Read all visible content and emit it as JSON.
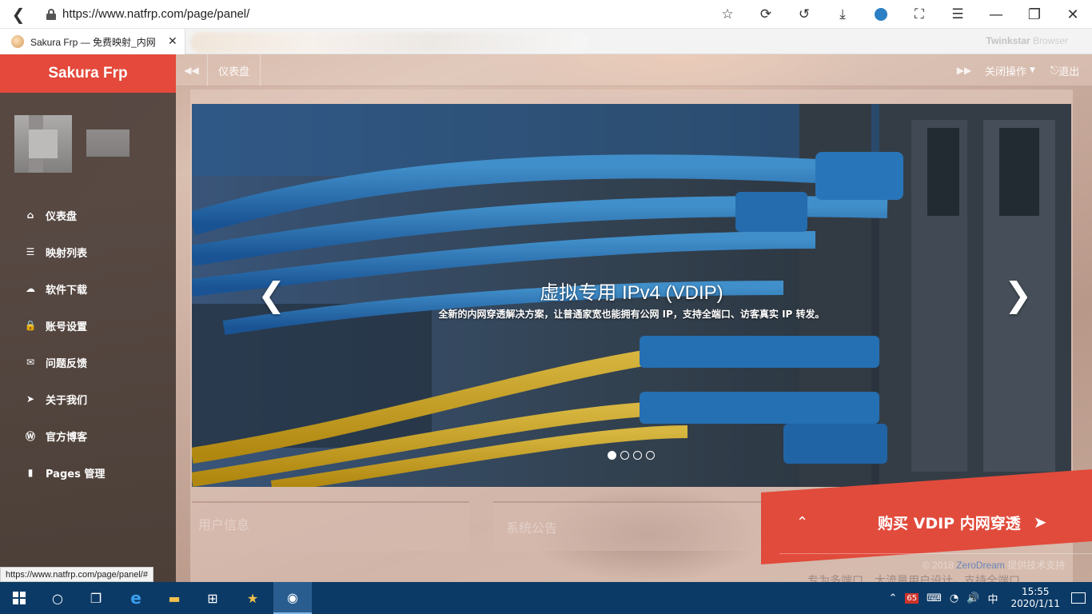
{
  "browser": {
    "url": "https://www.natfrp.com/page/panel/",
    "tab_title": "Sakura Frp — 免费映射_内网",
    "brand_name": "Twinkstar",
    "brand_suffix": " Browser",
    "status_url": "https://www.natfrp.com/page/panel/#"
  },
  "sidebar": {
    "logo": "Sakura Frp",
    "items": [
      {
        "label": "仪表盘",
        "icon": "home-icon",
        "glyph": "⌂"
      },
      {
        "label": "映射列表",
        "icon": "list-icon",
        "glyph": "☰"
      },
      {
        "label": "软件下载",
        "icon": "cloud-download-icon",
        "glyph": "☁"
      },
      {
        "label": "账号设置",
        "icon": "lock-icon",
        "glyph": "🔒"
      },
      {
        "label": "问题反馈",
        "icon": "envelope-icon",
        "glyph": "✉"
      },
      {
        "label": "关于我们",
        "icon": "paper-plane-icon",
        "glyph": "➤"
      },
      {
        "label": "官方博客",
        "icon": "wordpress-icon",
        "glyph": "Ⓦ"
      },
      {
        "label": "Pages 管理",
        "icon": "file-icon",
        "glyph": "▮"
      }
    ]
  },
  "topnav": {
    "breadcrumb": "仪表盘",
    "ops_label": "关闭操作",
    "logout_label": "退出"
  },
  "carousel": {
    "title": "虚拟专用 IPv4 (VDIP)",
    "subtitle": "全新的内网穿透解决方案，让普通家宽也能拥有公网 IP，支持全端口、访客真实 IP 转发。",
    "slide_count": 4,
    "active_index": 0
  },
  "panels": {
    "user_info": "用户信息",
    "notice": "系统公告"
  },
  "buy_button": {
    "label": "购买 VDIP 内网穿透"
  },
  "footer": {
    "copyright": "© 2018 ",
    "company": "ZeroDream",
    "support": " 提供技术支持",
    "marquee": "专为多端口、大流量用户设计，支持全端口"
  },
  "taskbar": {
    "time": "15:55",
    "date": "2020/1/11",
    "badge": "65",
    "ime": "中"
  },
  "colors": {
    "brand_red": "#e4493b",
    "taskbar_blue": "#0c3a66"
  }
}
